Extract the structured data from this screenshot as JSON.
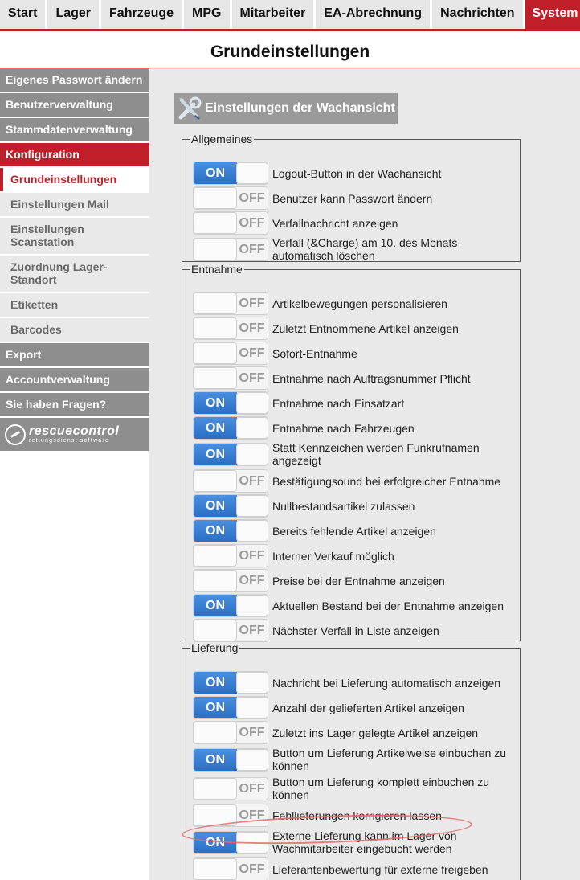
{
  "nav": {
    "tabs": [
      {
        "label": "Start"
      },
      {
        "label": "Lager"
      },
      {
        "label": "Fahrzeuge"
      },
      {
        "label": "MPG"
      },
      {
        "label": "Mitarbeiter"
      },
      {
        "label": "EA-Abrechnung"
      },
      {
        "label": "Nachrichten"
      },
      {
        "label": "System"
      }
    ],
    "active_index": 7
  },
  "page_title": "Grundeinstellungen",
  "sidebar": {
    "top_items": [
      {
        "label": "Eigenes Passwort ändern"
      },
      {
        "label": "Benutzerverwaltung"
      },
      {
        "label": "Stammdatenverwaltung"
      },
      {
        "label": "Konfiguration"
      }
    ],
    "sub_items": [
      {
        "label": "Grundeinstellungen"
      },
      {
        "label": "Einstellungen Mail"
      },
      {
        "label": "Einstellungen Scanstation"
      },
      {
        "label": "Zuordnung Lager-Standort"
      },
      {
        "label": "Etiketten"
      },
      {
        "label": "Barcodes"
      }
    ],
    "bottom_items": [
      {
        "label": "Export"
      },
      {
        "label": "Accountverwaltung"
      },
      {
        "label": "Sie haben Fragen?"
      }
    ],
    "logo": {
      "name": "rescuecontrol",
      "tagline": "rettungsdienst software"
    }
  },
  "section_title": "Einstellungen der Wachansicht",
  "toggle_text": {
    "on": "ON",
    "off": "OFF"
  },
  "groups": [
    {
      "legend": "Allgemeines",
      "settings": [
        {
          "label": "Logout-Button in der Wachansicht",
          "on": true
        },
        {
          "label": "Benutzer kann Passwort ändern",
          "on": false
        },
        {
          "label": "Verfallnachricht anzeigen",
          "on": false
        },
        {
          "label": "Verfall (&Charge) am 10. des Monats automatisch löschen",
          "on": false
        }
      ]
    },
    {
      "legend": "Entnahme",
      "settings": [
        {
          "label": "Artikelbewegungen personalisieren",
          "on": false
        },
        {
          "label": "Zuletzt Entnommene Artikel anzeigen",
          "on": false
        },
        {
          "label": "Sofort-Entnahme",
          "on": false
        },
        {
          "label": "Entnahme nach Auftragsnummer Pflicht",
          "on": false
        },
        {
          "label": "Entnahme nach Einsatzart",
          "on": true
        },
        {
          "label": "Entnahme nach Fahrzeugen",
          "on": true
        },
        {
          "label": "Statt Kennzeichen werden Funkrufnamen angezeigt",
          "on": true
        },
        {
          "label": "Bestätigungsound bei erfolgreicher Entnahme",
          "on": false
        },
        {
          "label": "Nullbestandsartikel zulassen",
          "on": true
        },
        {
          "label": "Bereits fehlende Artikel anzeigen",
          "on": true
        },
        {
          "label": "Interner Verkauf möglich",
          "on": false
        },
        {
          "label": "Preise bei der Entnahme anzeigen",
          "on": false
        },
        {
          "label": "Aktuellen Bestand bei der Entnahme anzeigen",
          "on": true
        },
        {
          "label": "Nächster Verfall in Liste anzeigen",
          "on": false
        }
      ]
    },
    {
      "legend": "Lieferung",
      "settings": [
        {
          "label": "Nachricht bei Lieferung automatisch anzeigen",
          "on": true
        },
        {
          "label": "Anzahl der gelieferten Artikel anzeigen",
          "on": true
        },
        {
          "label": "Zuletzt ins Lager gelegte Artikel anzeigen",
          "on": false
        },
        {
          "label": "Button um Lieferung Artikelweise einbuchen zu können",
          "on": true
        },
        {
          "label": "Button um Lieferung komplett einbuchen zu können",
          "on": false
        },
        {
          "label": "Fehllieferungen korrigieren lassen",
          "on": false
        },
        {
          "label": "Externe Lieferung kann im Lager von Wachmitarbeiter eingebucht werden",
          "on": true
        },
        {
          "label": "Lieferantenbewertung für externe freigeben",
          "on": false
        }
      ]
    }
  ],
  "colors": {
    "accent": "#c01e28",
    "toggle_on": "#2f76cf",
    "sidebar_bg": "#8e8e8e",
    "main_bg": "#e9e9e9"
  }
}
